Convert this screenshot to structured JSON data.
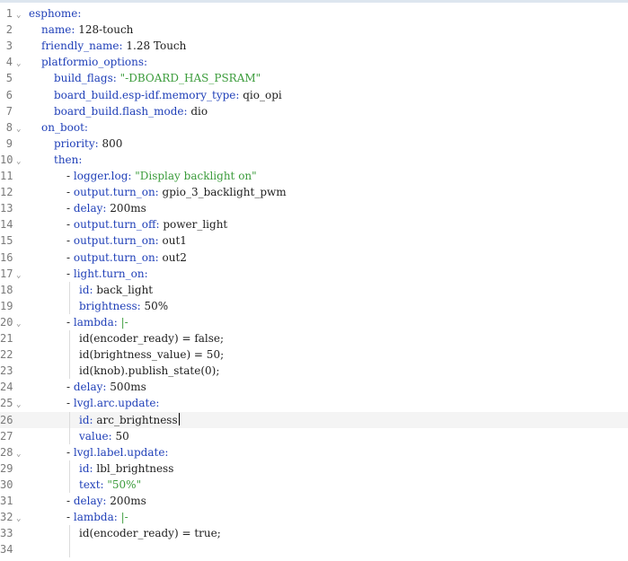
{
  "editor": {
    "lines": [
      {
        "n": "1",
        "indent": 0,
        "fold": true,
        "key": "esphome:"
      },
      {
        "n": "2",
        "indent": 1,
        "key": "name:",
        "value": " 128-touch"
      },
      {
        "n": "3",
        "indent": 1,
        "key": "friendly_name:",
        "value": " 1.28 Touch"
      },
      {
        "n": "4",
        "indent": 1,
        "fold": true,
        "key": "platformio_options:"
      },
      {
        "n": "5",
        "indent": 2,
        "key": "build_flags:",
        "str": " \"-DBOARD_HAS_PSRAM\""
      },
      {
        "n": "6",
        "indent": 2,
        "key": "board_build.esp-idf.memory_type:",
        "value": " qio_opi"
      },
      {
        "n": "7",
        "indent": 2,
        "key": "board_build.flash_mode:",
        "value": " dio"
      },
      {
        "n": "8",
        "indent": 1,
        "fold": true,
        "key": "on_boot:"
      },
      {
        "n": "9",
        "indent": 2,
        "key": "priority:",
        "value": " 800"
      },
      {
        "n": "10",
        "indent": 2,
        "fold": true,
        "key": "then:"
      },
      {
        "n": "11",
        "indent": 3,
        "dash": true,
        "key": "logger.log:",
        "str": " \"Display backlight on\""
      },
      {
        "n": "12",
        "indent": 3,
        "dash": true,
        "key": "output.turn_on:",
        "value": " gpio_3_backlight_pwm"
      },
      {
        "n": "13",
        "indent": 3,
        "dash": true,
        "key": "delay:",
        "value": " 200ms"
      },
      {
        "n": "14",
        "indent": 3,
        "dash": true,
        "key": "output.turn_off:",
        "value": " power_light"
      },
      {
        "n": "15",
        "indent": 3,
        "dash": true,
        "key": "output.turn_on:",
        "value": " out1"
      },
      {
        "n": "16",
        "indent": 3,
        "dash": true,
        "key": "output.turn_on:",
        "value": " out2"
      },
      {
        "n": "17",
        "indent": 3,
        "dash": true,
        "fold": true,
        "key": "light.turn_on:"
      },
      {
        "n": "18",
        "indent": 4,
        "key": "id:",
        "value": " back_light"
      },
      {
        "n": "19",
        "indent": 4,
        "key": "brightness:",
        "value": " 50%"
      },
      {
        "n": "20",
        "indent": 3,
        "dash": true,
        "fold": true,
        "key": "lambda:",
        "pipe": " |-"
      },
      {
        "n": "21",
        "indent": 4,
        "value": "id(encoder_ready) = false;"
      },
      {
        "n": "22",
        "indent": 4,
        "value": "id(brightness_value) = 50;"
      },
      {
        "n": "23",
        "indent": 4,
        "value": "id(knob).publish_state(0);"
      },
      {
        "n": "24",
        "indent": 3,
        "dash": true,
        "key": "delay:",
        "value": " 500ms"
      },
      {
        "n": "25",
        "indent": 3,
        "dash": true,
        "fold": true,
        "key": "lvgl.arc.update:"
      },
      {
        "n": "26",
        "indent": 4,
        "key": "id:",
        "value": " arc_brightness",
        "current": true
      },
      {
        "n": "27",
        "indent": 4,
        "key": "value:",
        "value": " 50"
      },
      {
        "n": "28",
        "indent": 3,
        "dash": true,
        "fold": true,
        "key": "lvgl.label.update:"
      },
      {
        "n": "29",
        "indent": 4,
        "key": "id:",
        "value": " lbl_brightness"
      },
      {
        "n": "30",
        "indent": 4,
        "key": "text:",
        "str": " \"50%\""
      },
      {
        "n": "31",
        "indent": 3,
        "dash": true,
        "key": "delay:",
        "value": " 200ms"
      },
      {
        "n": "32",
        "indent": 3,
        "dash": true,
        "fold": true,
        "key": "lambda:",
        "pipe": " |-"
      },
      {
        "n": "33",
        "indent": 4,
        "value": "id(encoder_ready) = true;"
      },
      {
        "n": "34",
        "indent": 4,
        "value": ""
      }
    ]
  }
}
